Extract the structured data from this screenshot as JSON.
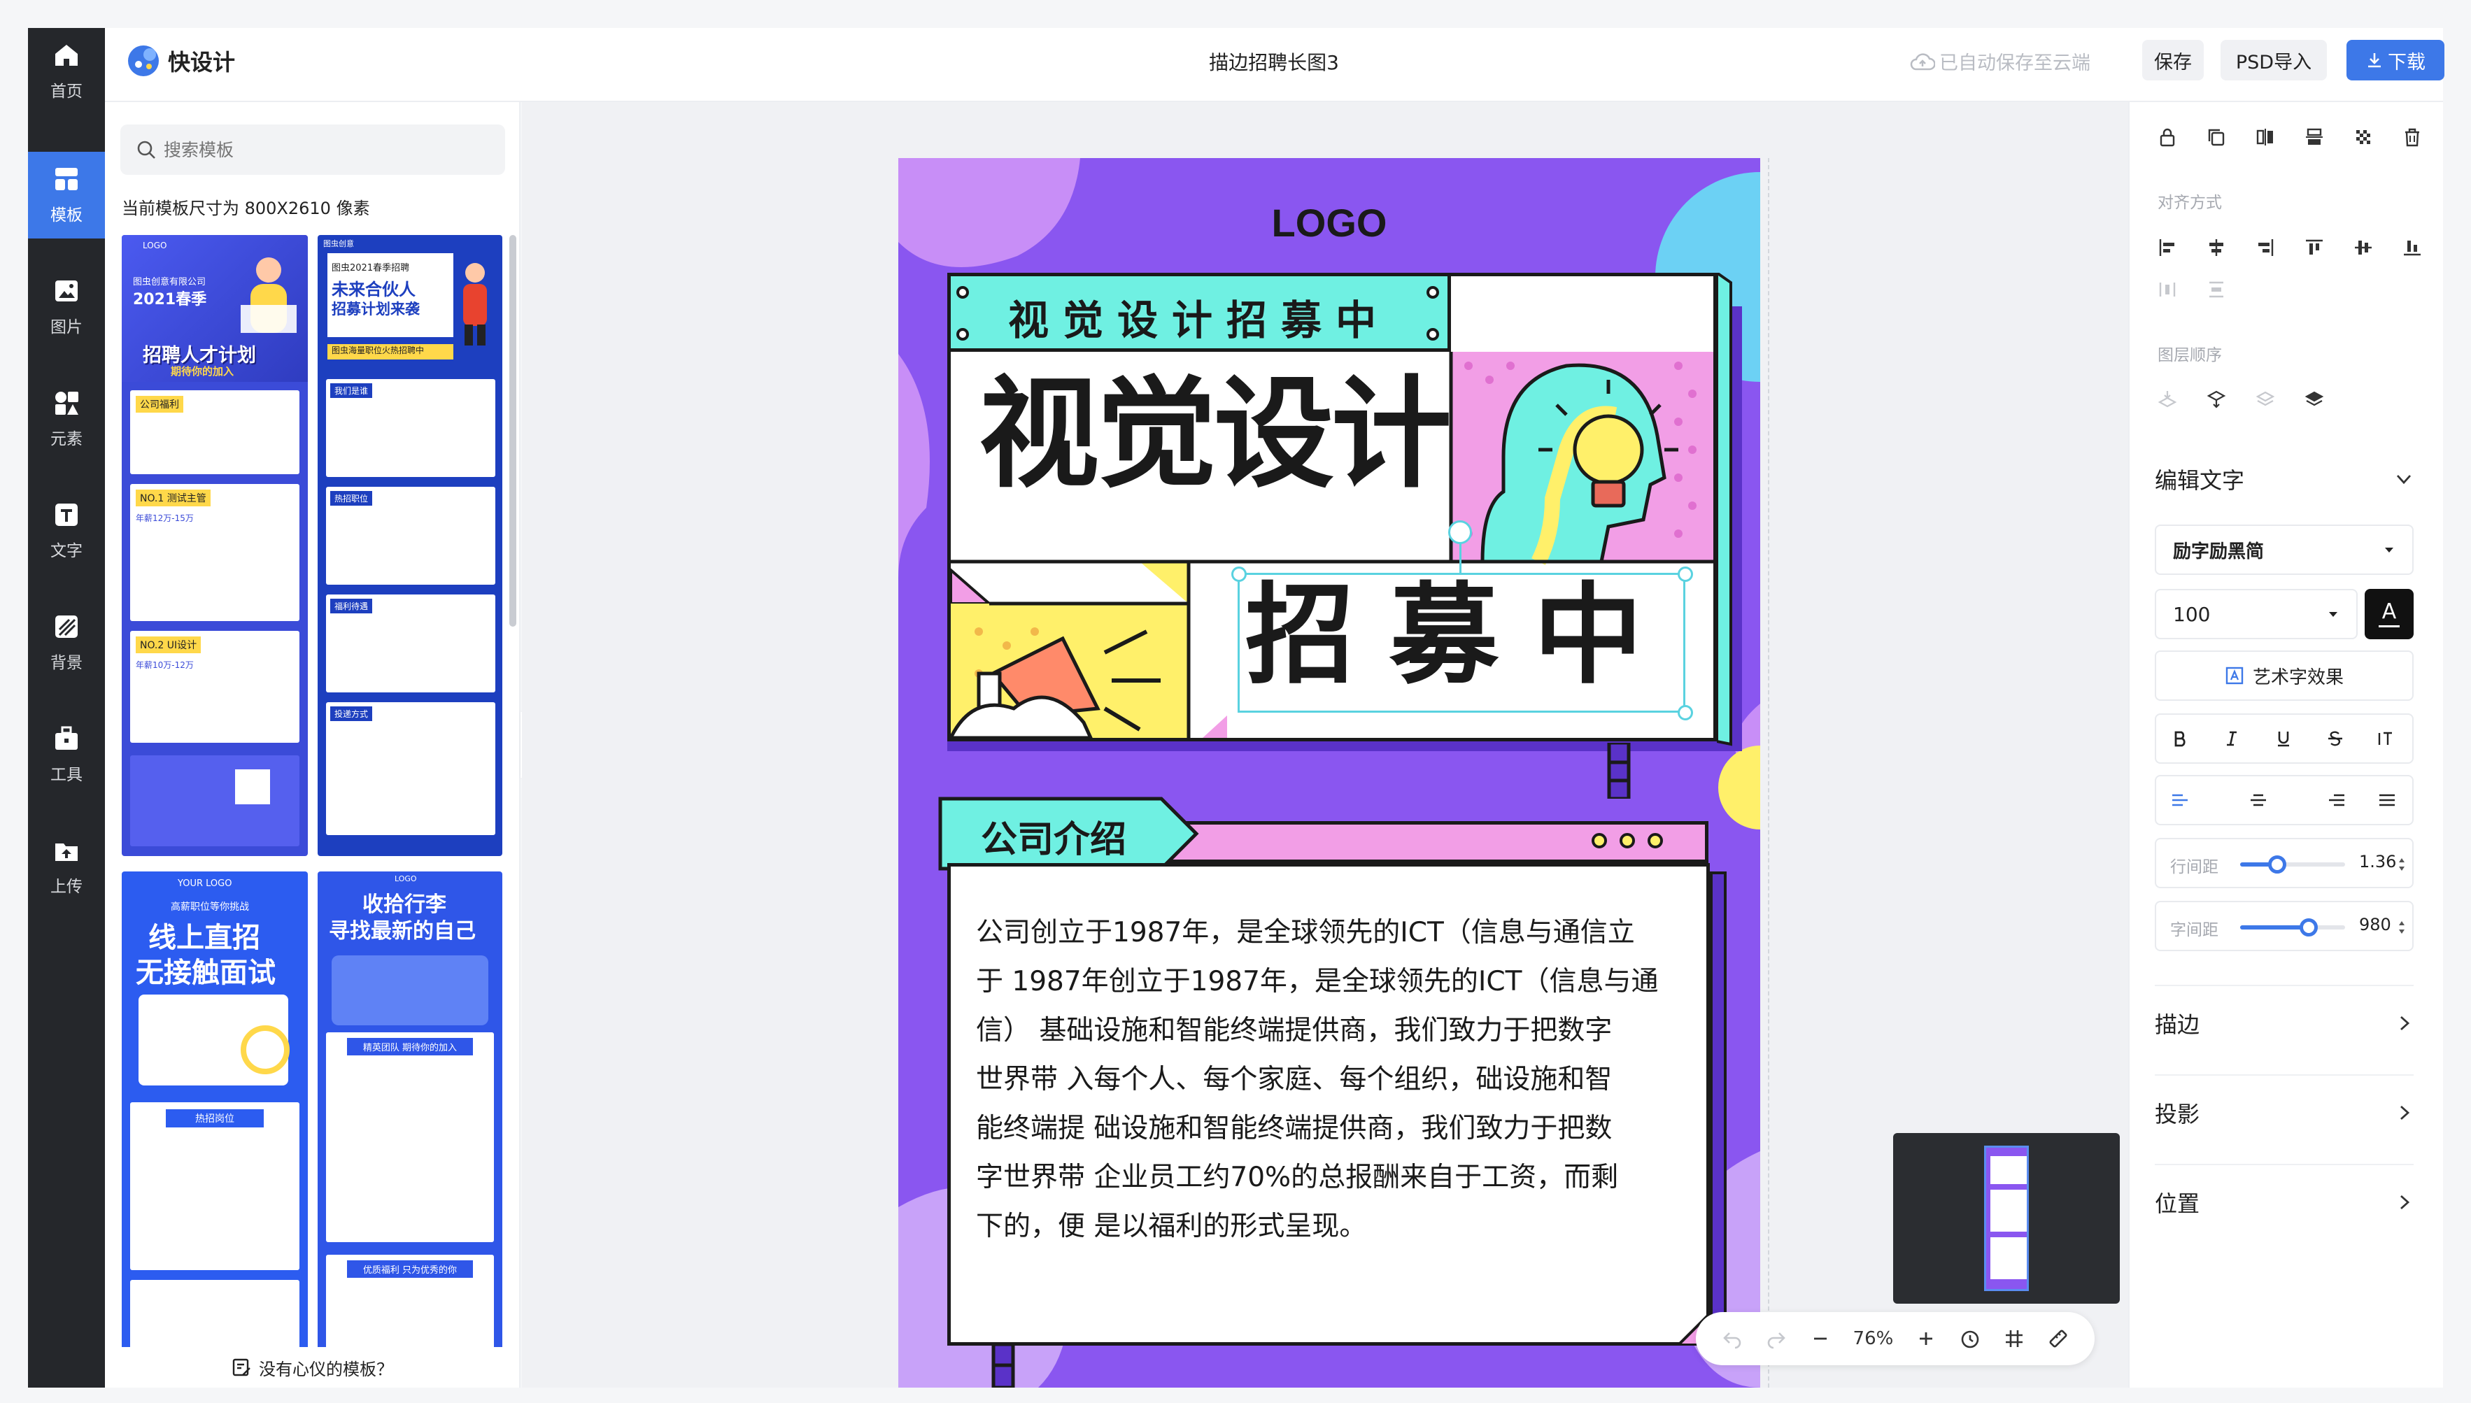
{
  "app": {
    "name": "快设计",
    "doc_title": "描边招聘长图3"
  },
  "header": {
    "autosave": "已自动保存至云端",
    "save": "保存",
    "psd_import": "PSD导入",
    "download": "下载"
  },
  "nav": [
    {
      "id": "home",
      "label": "首页",
      "icon": "home-icon"
    },
    {
      "id": "template",
      "label": "模板",
      "icon": "template-icon"
    },
    {
      "id": "image",
      "label": "图片",
      "icon": "image-icon"
    },
    {
      "id": "element",
      "label": "元素",
      "icon": "elements-icon"
    },
    {
      "id": "text",
      "label": "文字",
      "icon": "text-icon"
    },
    {
      "id": "background",
      "label": "背景",
      "icon": "background-icon"
    },
    {
      "id": "tools",
      "label": "工具",
      "icon": "toolbox-icon"
    },
    {
      "id": "upload",
      "label": "上传",
      "icon": "upload-icon"
    }
  ],
  "nav_active": "template",
  "left_panel": {
    "search_placeholder": "搜索模板",
    "size_info": "当前模板尺寸为 800X2610 像素",
    "footer": "没有心仪的模板？",
    "templates": [
      {
        "logo": "LOGO",
        "company": "图虫创意有限公司",
        "year": "2021春季",
        "title": "招聘人才计划",
        "sub": "期待你的加入",
        "s1": "公司福利",
        "s2": "NO.1 测试主管",
        "s2_pay": "年薪12万-15万",
        "s3": "NO.2 UI设计",
        "s3_pay": "年薪10万-12万"
      },
      {
        "brand": "图虫创意",
        "l1": "图虫2021春季招聘",
        "title": "未来合伙人",
        "sub": "招募计划来袭",
        "bar": "图虫海量职位火热招聘中",
        "s1": "我们是谁",
        "s2": "热招职位",
        "s3": "福利待遇",
        "s4": "投递方式"
      },
      {
        "logo": "YOUR LOGO",
        "l1": "高薪职位等你挑战",
        "title1": "线上直招",
        "title2": "无接触面试",
        "s1": "热招岗位"
      },
      {
        "logo": "LOGO",
        "title1": "收拾行李",
        "title2": "寻找最新的自己",
        "s1": "精英团队 期待你的加入",
        "s2": "优质福利 只为优秀的你"
      }
    ]
  },
  "poster": {
    "logo": "LOGO",
    "banner": "视觉设计招募中",
    "title1": "视觉设计",
    "title2": "招募中",
    "section_title": "公司介绍",
    "body": "公司创立于1987年，是全球领先的ICT（信息与通信立于 1987年创立于1987年，是全球领先的ICT（信息与通信） 基础设施和智能终端提供商，我们致力于把数字世界带 入每个人、每个家庭、每个组织，础设施和智能终端提 础设施和智能终端提供商，我们致力于把数字世界带 企业员工约70%的总报酬来自于工资，而剩下的，便 是以福利的形式呈现。",
    "body_lines": [
      "公司创立于1987年，是全球领先的ICT（信息与通信立",
      "于 1987年创立于1987年，是全球领先的ICT（信息与通",
      "信） 基础设施和智能终端提供商，我们致力于把数字",
      "世界带 入每个人、每个家庭、每个组织，础设施和智",
      "能终端提 础设施和智能终端提供商，我们致力于把数",
      "字世界带 企业员工约70%的总报酬来自于工资，而剩",
      "下的，便 是以福利的形式呈现。"
    ]
  },
  "zoom": {
    "value": "76%"
  },
  "right_panel": {
    "align_label": "对齐方式",
    "layer_label": "图层顺序",
    "edit_text": "编辑文字",
    "font_family": "励字励黑简",
    "font_size": "100",
    "color_letter": "A",
    "art_effect": "艺术字效果",
    "line_height_label": "行间距",
    "line_height_value": "1.36",
    "line_height_level": 0.35,
    "letter_spacing_label": "字间距",
    "letter_spacing_value": "980",
    "letter_spacing_level": 0.65,
    "sections": [
      "描边",
      "投影",
      "位置"
    ]
  },
  "colors": {
    "accent": "#3d78e8",
    "nav_bg": "#25272b",
    "poster_purple": "#8a56f0",
    "poster_cyan": "#6ff0e2",
    "poster_yellow": "#fff06a",
    "poster_pink": "#f29ee6",
    "selection": "#5ad2e0"
  }
}
